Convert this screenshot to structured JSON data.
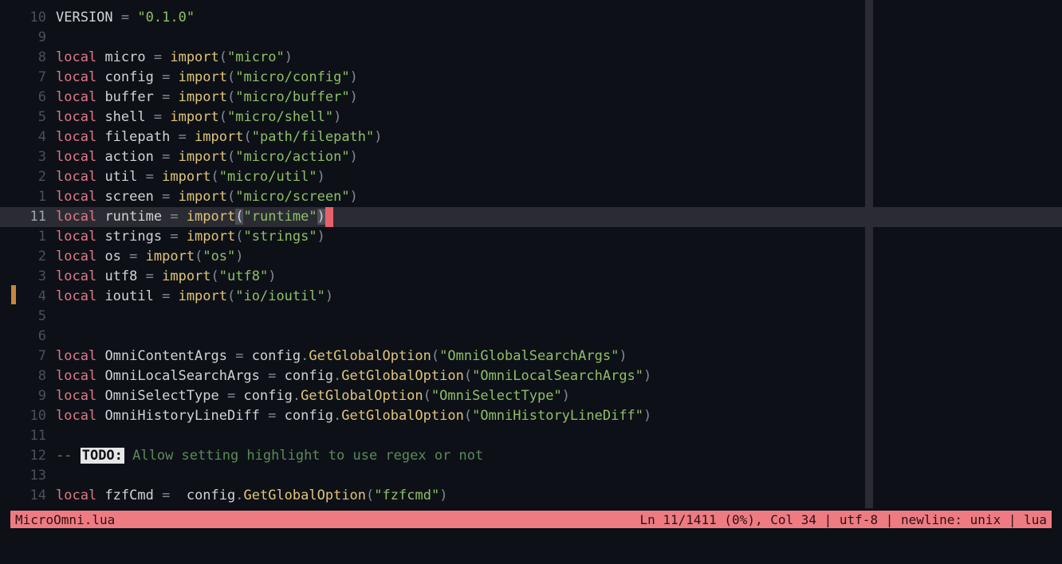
{
  "gutter": {
    "l0": "10",
    "l1": "9",
    "l2": "8",
    "l3": "7",
    "l4": "6",
    "l5": "5",
    "l6": "4",
    "l7": "3",
    "l8": "2",
    "l9": "1",
    "l10": "11",
    "l11": "1",
    "l12": "2",
    "l13": "3",
    "l14": "4",
    "l15": "5",
    "l16": "6",
    "l17": "7",
    "l18": "8",
    "l19": "9",
    "l20": "10",
    "l21": "11",
    "l22": "12",
    "l23": "13",
    "l24": "14"
  },
  "code": {
    "local": "local",
    "import": "import",
    "eq": " = ",
    "op": "(",
    "cp": ")",
    "q": "\"",
    "dot": ".",
    "dashdash": "-- ",
    "todo": "TODO:",
    "comment_text": " Allow setting highlight to use regex or not",
    "version_name": "VERSION",
    "version_val": "0.1.0",
    "vars": {
      "micro": "micro",
      "config": "config",
      "buffer": "buffer",
      "shell": "shell",
      "filepath": "filepath",
      "action": "action",
      "util": "util",
      "screen": "screen",
      "runtime": "runtime",
      "strings": "strings",
      "os": "os",
      "utf8": "utf8",
      "ioutil": "ioutil",
      "OmniContentArgs": "OmniContentArgs",
      "OmniLocalSearchArgs": "OmniLocalSearchArgs",
      "OmniSelectType": "OmniSelectType",
      "OmniHistoryLineDiff": "OmniHistoryLineDiff",
      "fzfCmd": "fzfCmd"
    },
    "imports": {
      "micro": "micro",
      "config": "micro/config",
      "buffer": "micro/buffer",
      "shell": "micro/shell",
      "filepath": "path/filepath",
      "action": "micro/action",
      "util": "micro/util",
      "screen": "micro/screen",
      "runtime": "runtime",
      "strings": "strings",
      "os": "os",
      "utf8": "utf8",
      "ioutil": "io/ioutil"
    },
    "cfg": {
      "obj": "config",
      "call": "GetGlobalOption",
      "args": {
        "a1": "OmniGlobalSearchArgs",
        "a2": "OmniLocalSearchArgs",
        "a3": "OmniSelectType",
        "a4": "OmniHistoryLineDiff",
        "a5": "fzfcmd"
      }
    }
  },
  "status": {
    "file": "MicroOmni.lua",
    "right": "Ln 11/1411 (0%), Col 34 | utf-8 | newline: unix | lua"
  }
}
